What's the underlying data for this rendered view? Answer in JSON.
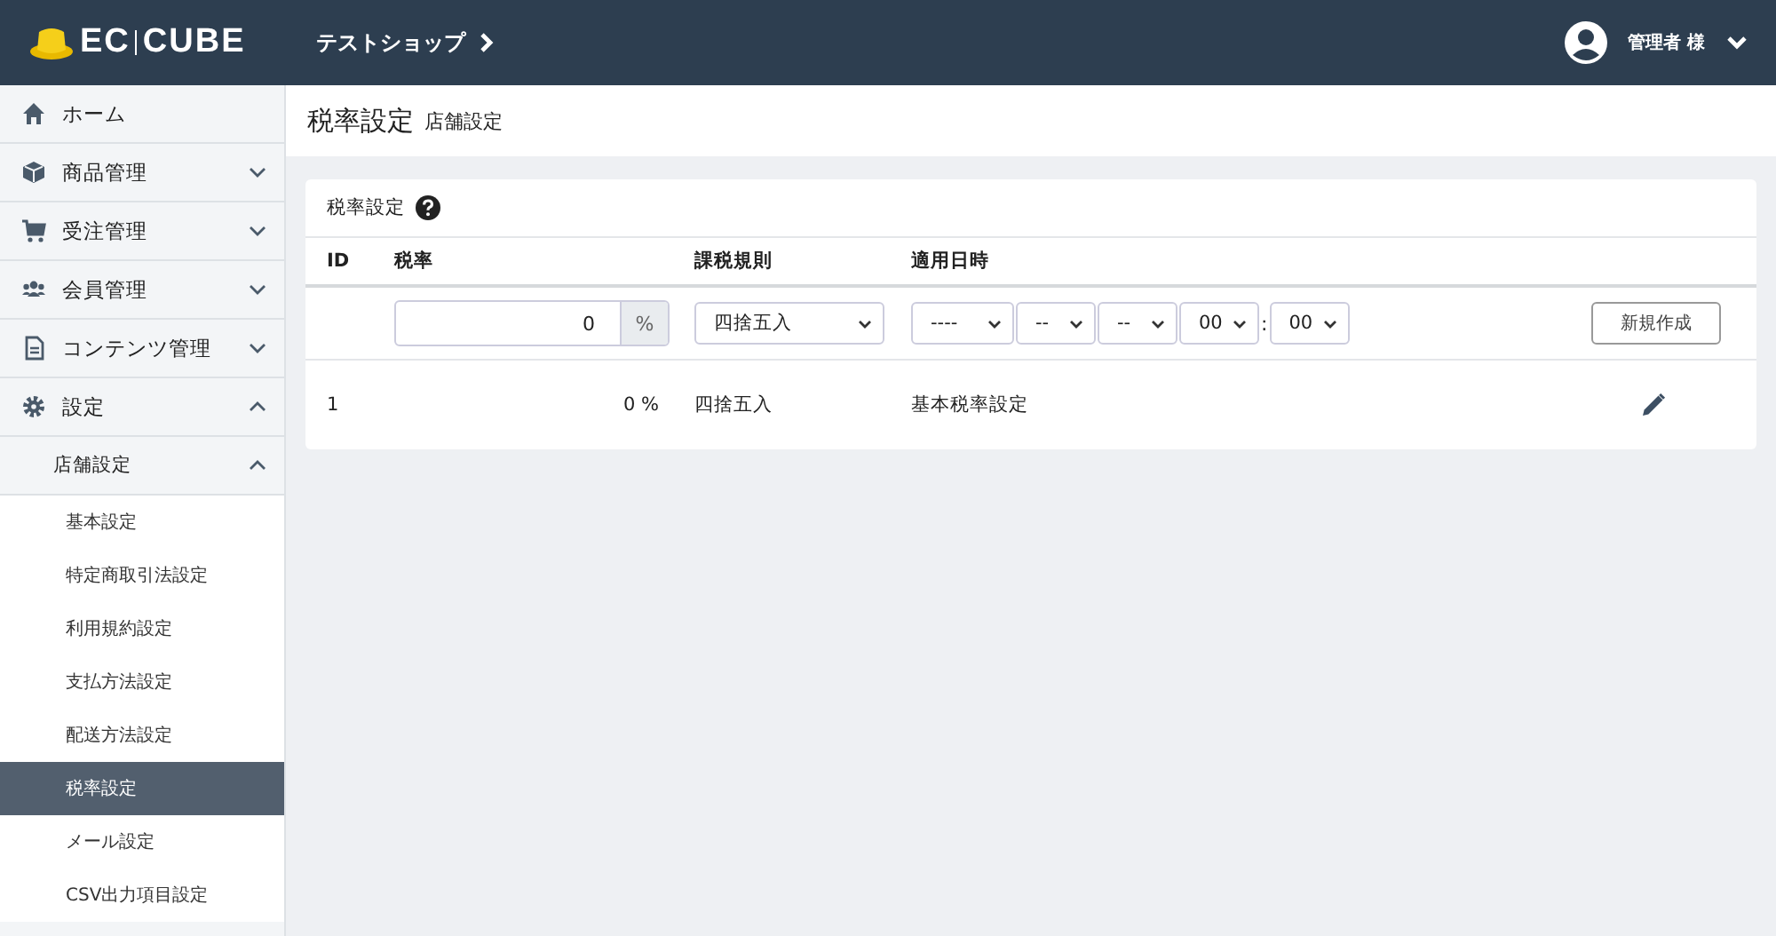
{
  "header": {
    "logo": {
      "left": "EC",
      "right": "CUBE"
    },
    "shop": "テストショップ",
    "user": "管理者 様"
  },
  "sidebar": {
    "items": [
      {
        "kind": "home",
        "label": "ホーム"
      },
      {
        "kind": "box",
        "label": "商品管理",
        "expanded": false
      },
      {
        "kind": "cart",
        "label": "受注管理",
        "expanded": false
      },
      {
        "kind": "users",
        "label": "会員管理",
        "expanded": false
      },
      {
        "kind": "file",
        "label": "コンテンツ管理",
        "expanded": false
      },
      {
        "kind": "gear",
        "label": "設定",
        "expanded": true,
        "children": [
          {
            "label": "店舗設定",
            "expanded": true,
            "children": [
              {
                "label": "基本設定",
                "selected": false
              },
              {
                "label": "特定商取引法設定",
                "selected": false
              },
              {
                "label": "利用規約設定",
                "selected": false
              },
              {
                "label": "支払方法設定",
                "selected": false
              },
              {
                "label": "配送方法設定",
                "selected": false
              },
              {
                "label": "税率設定",
                "selected": true
              },
              {
                "label": "メール設定",
                "selected": false
              },
              {
                "label": "CSV出力項目設定",
                "selected": false
              }
            ]
          }
        ]
      }
    ]
  },
  "page": {
    "title": "税率設定",
    "subtitle": "店舗設定"
  },
  "card": {
    "title": "税率設定",
    "table": {
      "columns": [
        "ID",
        "税率",
        "課税規則",
        "適用日時"
      ],
      "form": {
        "rate": "0",
        "unit": "%",
        "rule": "四捨五入",
        "date": [
          "----",
          "--",
          "--"
        ],
        "hour": "00",
        "separator": ":",
        "minute": "00",
        "button": "新規作成"
      },
      "rows": [
        {
          "id": "1",
          "rate": "0 %",
          "rule": "四捨五入",
          "date": "基本税率設定"
        }
      ]
    }
  }
}
